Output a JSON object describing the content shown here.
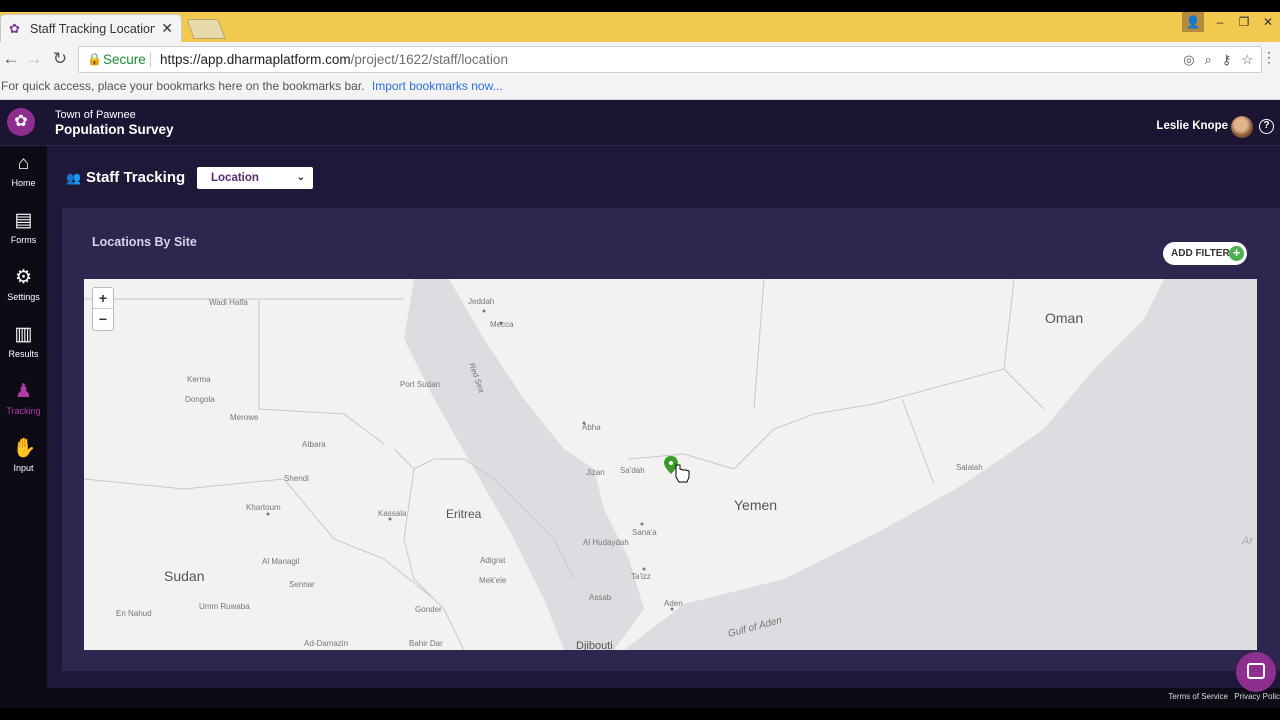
{
  "browser": {
    "tab_title": "Staff Tracking Locations - ",
    "tab_close": "✕",
    "url_secure": "Secure",
    "url_host": "https://app.dharmaplatform.com",
    "url_path": "/project/1622/staff/location",
    "bookmarks_text": "For quick access, place your bookmarks here on the bookmarks bar.",
    "bookmarks_link": "Import bookmarks now..."
  },
  "header": {
    "org_name": "Town of Pawnee",
    "project_name": "Population Survey",
    "user_name": "Leslie Knope",
    "help": "?"
  },
  "sidebar": {
    "items": [
      {
        "label": "Home",
        "icon": "home-icon",
        "glyph": "⌂"
      },
      {
        "label": "Forms",
        "icon": "clipboard-icon",
        "glyph": "▤"
      },
      {
        "label": "Settings",
        "icon": "gear-icon",
        "glyph": "⚙"
      },
      {
        "label": "Results",
        "icon": "bar-chart-icon",
        "glyph": "▥"
      },
      {
        "label": "Tracking",
        "icon": "location-person-icon",
        "glyph": "♟"
      },
      {
        "label": "Input",
        "icon": "hands-icon",
        "glyph": "✋"
      }
    ],
    "active": "Tracking",
    "active_color": "#b03aa8"
  },
  "page": {
    "title": "Staff Tracking",
    "select_value": "Location",
    "card_title": "Locations By Site",
    "add_filter": "ADD FILTER",
    "add_filter_plus": "+"
  },
  "map": {
    "zoom_in": "+",
    "zoom_out": "−",
    "labels": {
      "oman": "Oman",
      "yemen": "Yemen",
      "sudan": "Sudan",
      "eritrea": "Eritrea",
      "wadi_halfa": "Wadi Halfa",
      "jeddah": "Jeddah",
      "mecca": "Mecca",
      "red_sea": "Red Sea",
      "port_sudan": "Port Sudan",
      "kerma": "Kerma",
      "dongola": "Dongola",
      "merowe": "Merowe",
      "atbara": "Atbara",
      "shendi": "Shendi",
      "khartoum": "Khartoum",
      "kassala": "Kassala",
      "abha": "Abha",
      "jizan": "Jizan",
      "sadah": "Sa'dah",
      "salalah": "Salalah",
      "sanaa": "Sana'a",
      "al_hudaydah": "Al Hudaydah",
      "taizz": "Ta'izz",
      "aden": "Aden",
      "gulf_of_aden": "Gulf of Aden",
      "djibouti": "Djibouti",
      "al_managil": "Al Managil",
      "sennar": "Sennar",
      "en_nahud": "En Nahud",
      "umm_ruwaba": "Umm Ruwaba",
      "gonder": "Gonder",
      "adigrat": "Adigrat",
      "mekele": "Mek'ele",
      "assab": "Assab",
      "ad_damazin": "Ad-Damazin",
      "bahir_dar": "Bahir Dar",
      "arabian_sea_partial": "Ar"
    },
    "marker_color": "#3a9a2a"
  },
  "footer": {
    "terms": "Terms of Service",
    "privacy": "Privacy Polic"
  }
}
